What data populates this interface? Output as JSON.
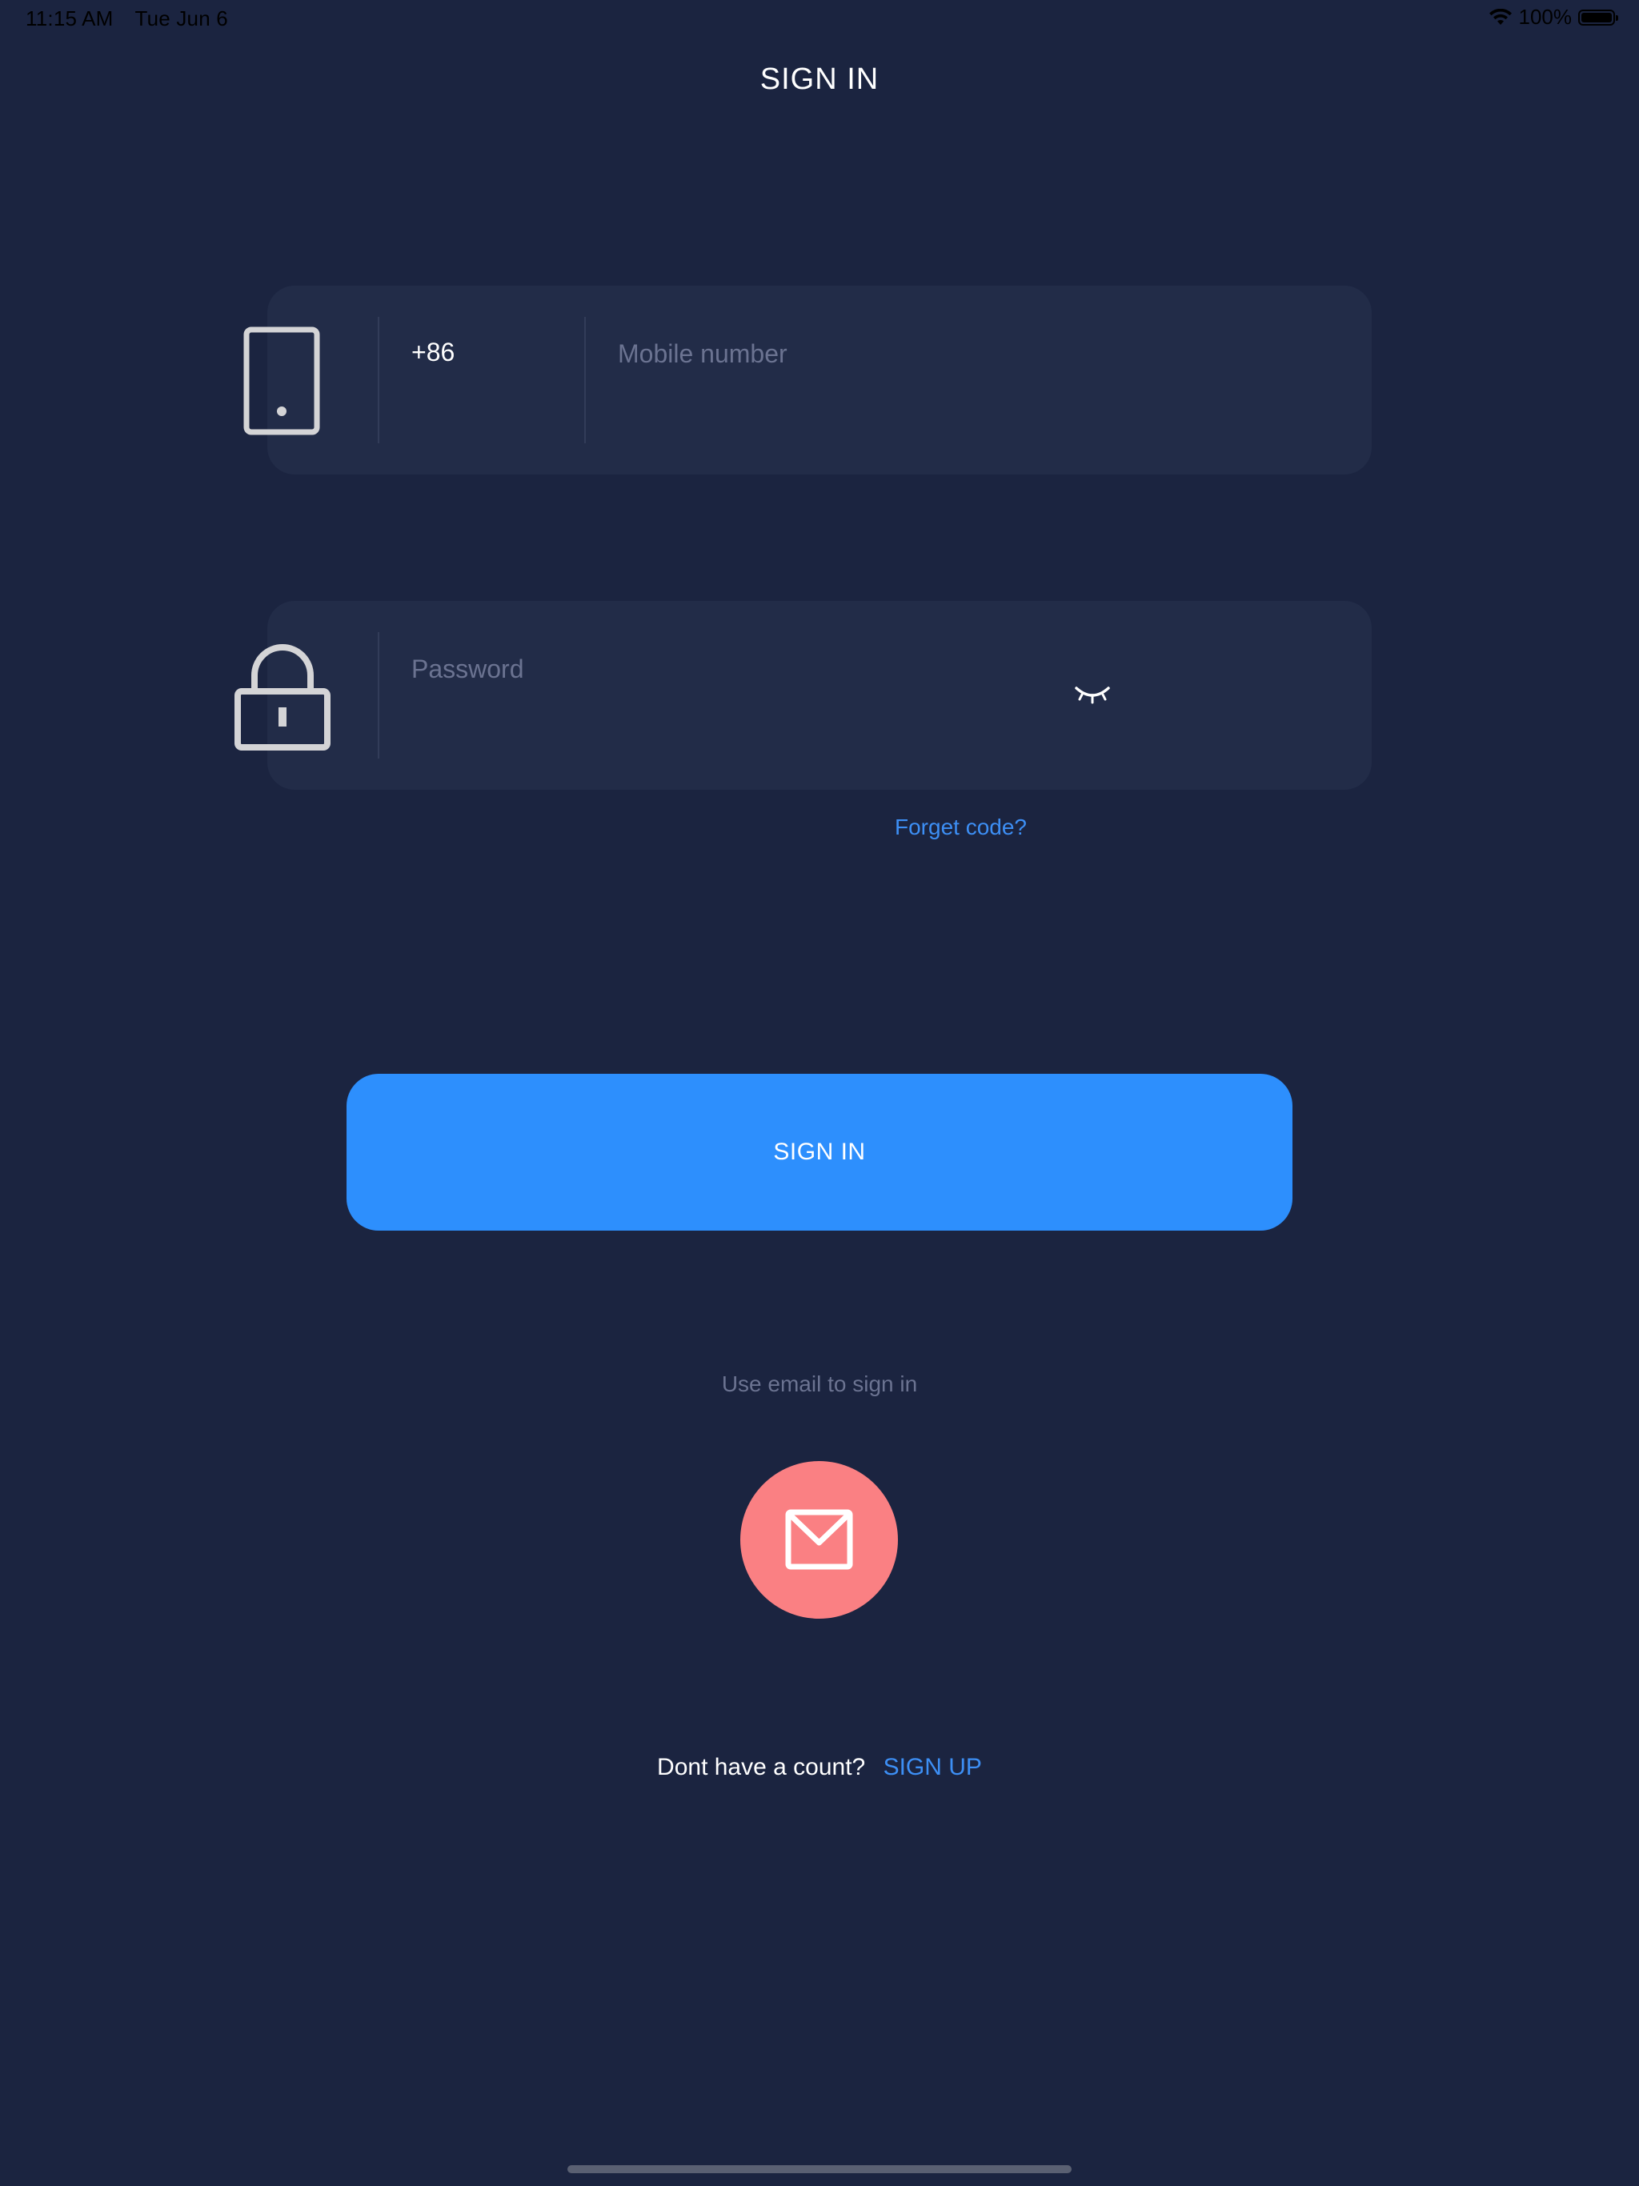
{
  "status_bar": {
    "time": "11:15 AM",
    "date": "Tue Jun 6",
    "battery": "100%",
    "icons": [
      "wifi-icon",
      "battery-icon"
    ]
  },
  "header": {
    "title": "SIGN IN"
  },
  "phone_field": {
    "icon": "phone-icon",
    "country_code": "+86",
    "placeholder": "Mobile number",
    "value": ""
  },
  "password_field": {
    "icon": "lock-icon",
    "placeholder": "Password",
    "value": "",
    "toggle_icon": "eye-closed-icon"
  },
  "forget_link": "Forget code?",
  "signin_button": "SIGN IN",
  "email_option": {
    "hint": "Use email to sign in",
    "icon": "mail-icon"
  },
  "signup": {
    "prompt": "Dont have a count?",
    "link": "SIGN UP"
  },
  "colors": {
    "background": "#1b2440",
    "field_background": "#222c48",
    "accent_blue": "#2d8ffd",
    "link_blue": "#3d8ff5",
    "email_button": "#fa8083",
    "placeholder": "#6b7391"
  }
}
